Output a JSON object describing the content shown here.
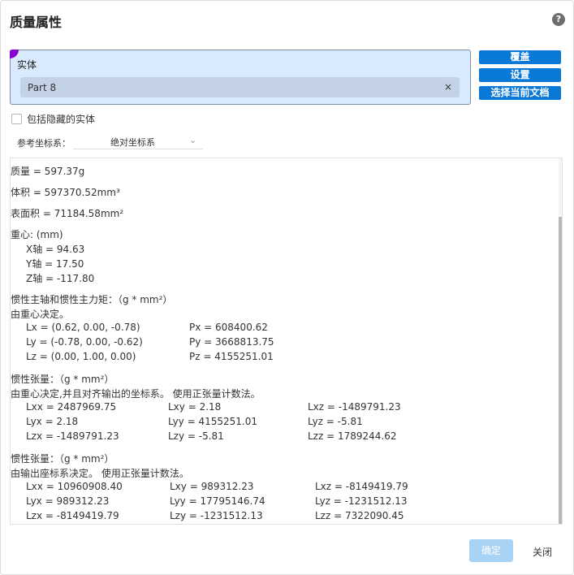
{
  "dialog": {
    "title": "质量属性",
    "help_glyph": "?"
  },
  "selection": {
    "label": "实体",
    "chip_text": "Part 8",
    "chip_close": "×"
  },
  "buttons": {
    "cover": "覆盖",
    "settings": "设置",
    "select_current_doc": "选择当前文档",
    "ok": "确定",
    "close": "关闭"
  },
  "options": {
    "include_hidden": "包括隐藏的实体",
    "ref_coord_label": "参考坐标系：",
    "ref_coord_value": "绝对坐标系"
  },
  "results": {
    "mass": "质量 = 597.37g",
    "volume": "体积 = 597370.52mm³",
    "surface_area": "表面积 = 71184.58mm²",
    "center_header": "重心: (mm)",
    "center_x": "X轴 = 94.63",
    "center_y": "Y轴 = 17.50",
    "center_z": "Z轴 = -117.80",
    "principal_header": "惯性主轴和惯性主力矩：（g * mm²）",
    "principal_note": "由重心决定。",
    "principal": {
      "lx": "Lx = (0.62, 0.00, -0.78)",
      "ly": "Ly = (-0.78, 0.00, -0.62)",
      "lz": "Lz = (0.00, 1.00, 0.00)",
      "px": "Px = 608400.62",
      "py": "Py = 3668813.75",
      "pz": "Pz = 4155251.01"
    },
    "tensor1_header": "惯性张量：（g * mm²）",
    "tensor1_note": "由重心决定,并且对齐输出的坐标系。 使用正张量计数法。",
    "tensor1": [
      [
        "Lxx = 2487969.75",
        "Lxy = 2.18",
        "Lxz = -1489791.23"
      ],
      [
        "Lyx = 2.18",
        "Lyy = 4155251.01",
        "Lyz = -5.81"
      ],
      [
        "Lzx = -1489791.23",
        "Lzy = -5.81",
        "Lzz = 1789244.62"
      ]
    ],
    "tensor2_header": "惯性张量：（g * mm²）",
    "tensor2_note": "由输出座标系决定。 使用正张量计数法。",
    "tensor2": [
      [
        "Lxx = 10960908.40",
        "Lxy = 989312.23",
        "Lxz = -8149419.79"
      ],
      [
        "Lyx = 989312.23",
        "Lyy = 17795146.74",
        "Lyz = -1231512.13"
      ],
      [
        "Lzx = -8149419.79",
        "Lzy = -1231512.13",
        "Lzz = 7322090.45"
      ]
    ]
  },
  "colors": {
    "primary_button": "#0a78d7",
    "selection_bg": "#d9eaff",
    "chip_bg": "#c3d2e6",
    "active_marker": "#8a00d4",
    "disabled_ok": "#a9d3f5"
  }
}
